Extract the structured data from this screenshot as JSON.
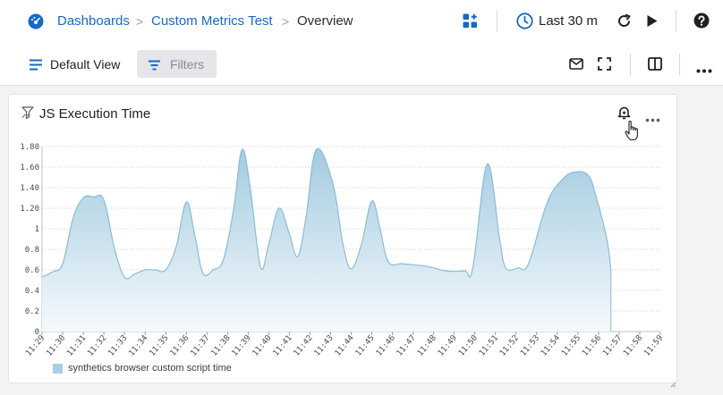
{
  "breadcrumb": {
    "items": [
      "Dashboards",
      "Custom Metrics Test"
    ],
    "separator": ">",
    "current": "Overview"
  },
  "toolbar": {
    "time_range": "Last 30 m",
    "view_label": "Default View",
    "filters_label": "Filters"
  },
  "icons": {
    "app": "app-logo-icon",
    "add_widget": "add-widget-icon",
    "clock": "clock-icon",
    "refresh": "refresh-icon",
    "play": "play-icon",
    "help": "help-icon",
    "view_list": "list-icon",
    "filter": "filter-icon",
    "mail": "mail-icon",
    "fullscreen": "fullscreen-icon",
    "split": "split-view-icon",
    "more": "more-icon",
    "panel_type": "chart-type-icon",
    "bell": "bell-icon",
    "resize": "resize-handle-icon"
  },
  "colors": {
    "accent": "#1669c7",
    "series_fill": "#a9cfe3",
    "series_line": "#8bbcd8"
  },
  "panel": {
    "title": "JS Execution Time"
  },
  "chart_data": {
    "type": "area",
    "title": "JS Execution Time",
    "x": [
      "11:29",
      "11:30",
      "11:31",
      "11:32",
      "11:33",
      "11:34",
      "11:35",
      "11:36",
      "11:37",
      "11:38",
      "11:39",
      "11:40",
      "11:41",
      "11:42",
      "11:43",
      "11:44",
      "11:45",
      "11:46",
      "11:47",
      "11:48",
      "11:49",
      "11:50",
      "11:51",
      "11:52",
      "11:53",
      "11:54",
      "11:55",
      "11:56",
      "11:57",
      "11:58",
      "11:59"
    ],
    "y_ticks": [
      "0",
      "0.2",
      "0.4",
      "0.6",
      "0.8",
      "1",
      "1.20",
      "1.40",
      "1.60",
      "1.80"
    ],
    "ylim": [
      0,
      1.8
    ],
    "grid": true,
    "legend_position": "bottom-left",
    "series": [
      {
        "name": "synthetics browser custom script time",
        "points": [
          [
            0.0,
            0.53
          ],
          [
            0.5,
            0.58
          ],
          [
            1.0,
            0.66
          ],
          [
            1.5,
            1.1
          ],
          [
            2.0,
            1.3
          ],
          [
            2.5,
            1.31
          ],
          [
            3.0,
            1.28
          ],
          [
            3.5,
            0.82
          ],
          [
            4.0,
            0.53
          ],
          [
            4.5,
            0.56
          ],
          [
            5.0,
            0.6
          ],
          [
            5.5,
            0.6
          ],
          [
            6.0,
            0.6
          ],
          [
            6.5,
            0.82
          ],
          [
            7.0,
            1.26
          ],
          [
            7.4,
            0.95
          ],
          [
            7.8,
            0.57
          ],
          [
            8.3,
            0.6
          ],
          [
            8.8,
            0.7
          ],
          [
            9.3,
            1.2
          ],
          [
            9.7,
            1.77
          ],
          [
            10.1,
            1.4
          ],
          [
            10.6,
            0.63
          ],
          [
            11.0,
            0.85
          ],
          [
            11.5,
            1.2
          ],
          [
            12.0,
            0.95
          ],
          [
            12.4,
            0.73
          ],
          [
            12.8,
            1.1
          ],
          [
            13.3,
            1.77
          ],
          [
            14.1,
            1.45
          ],
          [
            14.6,
            0.85
          ],
          [
            15.0,
            0.61
          ],
          [
            15.5,
            0.85
          ],
          [
            16.0,
            1.27
          ],
          [
            16.4,
            1.0
          ],
          [
            16.8,
            0.68
          ],
          [
            17.5,
            0.66
          ],
          [
            18.5,
            0.64
          ],
          [
            19.0,
            0.62
          ],
          [
            19.6,
            0.59
          ],
          [
            20.5,
            0.59
          ],
          [
            20.9,
            0.62
          ],
          [
            21.6,
            1.63
          ],
          [
            22.2,
            0.9
          ],
          [
            22.5,
            0.62
          ],
          [
            23.1,
            0.62
          ],
          [
            23.6,
            0.66
          ],
          [
            24.5,
            1.25
          ],
          [
            25.2,
            1.47
          ],
          [
            25.8,
            1.55
          ],
          [
            26.5,
            1.52
          ],
          [
            26.9,
            1.3
          ],
          [
            27.4,
            0.9
          ],
          [
            27.6,
            0.61
          ]
        ]
      }
    ]
  }
}
